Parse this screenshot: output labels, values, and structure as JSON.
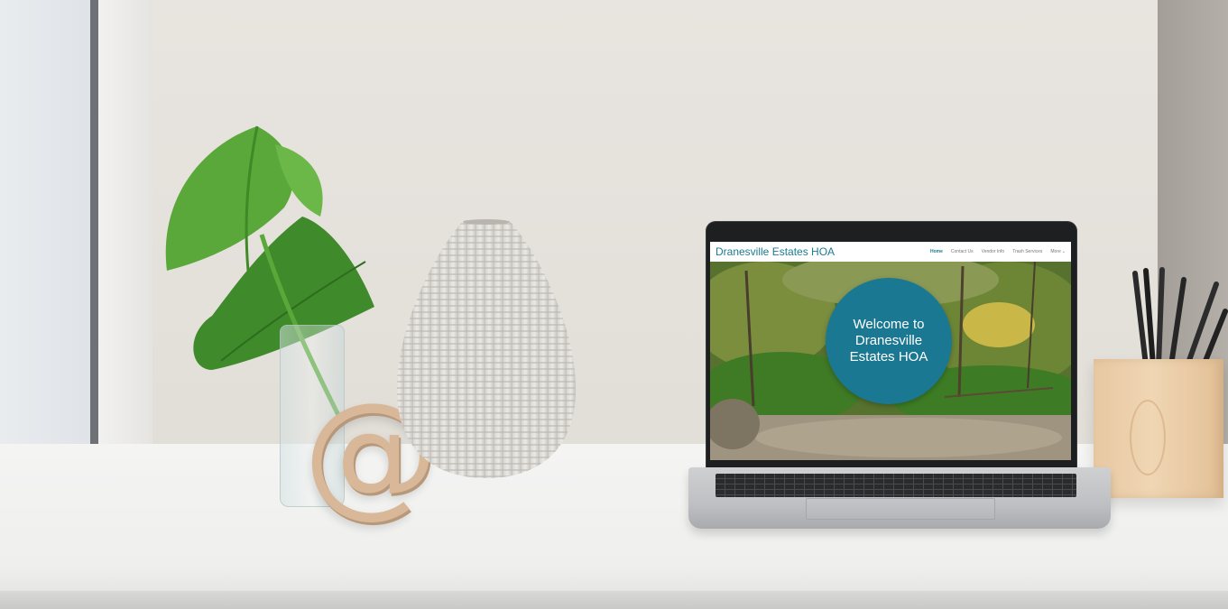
{
  "site": {
    "title": "Dranesville Estates HOA",
    "nav": [
      {
        "label": "Home",
        "active": true
      },
      {
        "label": "Contact Us",
        "active": false
      },
      {
        "label": "Vendor Info",
        "active": false
      },
      {
        "label": "Trash Services",
        "active": false
      },
      {
        "label": "More",
        "active": false
      }
    ],
    "hero_heading": "Welcome to Dranesville Estates HOA",
    "accent_color": "#1b7892"
  },
  "decor": {
    "at_symbol": "@",
    "icons": [
      "chevron-down-icon"
    ]
  }
}
